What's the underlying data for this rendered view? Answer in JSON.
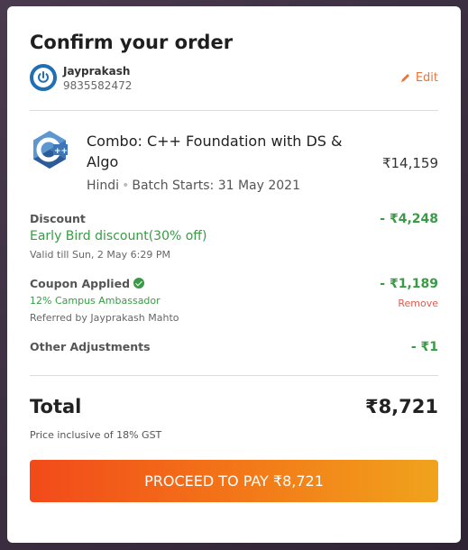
{
  "title": "Confirm your order",
  "user": {
    "name": "Jayprakash",
    "phone": "9835582472"
  },
  "edit_label": "Edit",
  "course": {
    "icon": "cpp-logo-icon",
    "name": "Combo: C++ Foundation with DS & Algo",
    "language": "Hindi",
    "batch": "Batch Starts: 31 May 2021",
    "price": "₹14,159"
  },
  "discount": {
    "label": "Discount",
    "name": "Early Bird discount(30% off)",
    "validity": "Valid till Sun, 2 May 6:29 PM",
    "amount": "- ₹4,248"
  },
  "coupon": {
    "label": "Coupon Applied",
    "name": "12% Campus Ambassador",
    "referred_by": "Referred by Jayprakash Mahto",
    "amount": "- ₹1,189",
    "remove_label": "Remove"
  },
  "adjustments": {
    "label": "Other Adjustments",
    "amount": "- ₹1"
  },
  "total": {
    "label": "Total",
    "amount": "₹8,721",
    "gst_note": "Price inclusive of 18% GST"
  },
  "pay_button": "PROCEED TO PAY ₹8,721",
  "colors": {
    "accent_orange": "#f37a18",
    "green": "#3a9a46",
    "remove_red": "#e05a4f",
    "avatar_blue": "#1f6fb2"
  }
}
